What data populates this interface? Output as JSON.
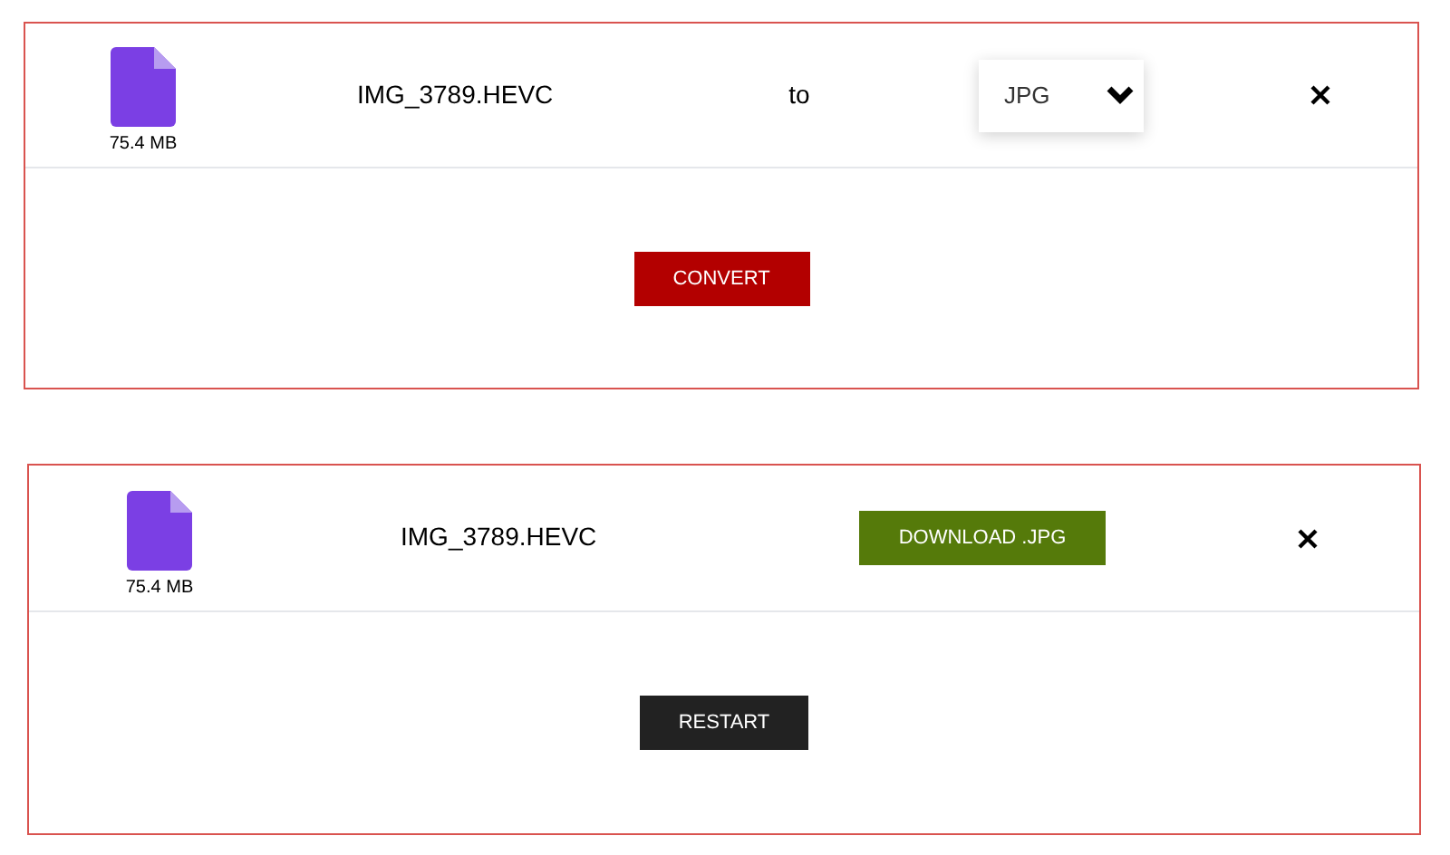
{
  "panels": [
    {
      "kind": "convert",
      "file": {
        "name": "IMG_3789.HEVC",
        "size": "75.4 MB"
      },
      "to_label": "to",
      "format": "JPG",
      "button": "CONVERT"
    },
    {
      "kind": "done",
      "file": {
        "name": "IMG_3789.HEVC",
        "size": "75.4 MB"
      },
      "download": "DOWNLOAD .JPG",
      "button": "RESTART"
    }
  ]
}
